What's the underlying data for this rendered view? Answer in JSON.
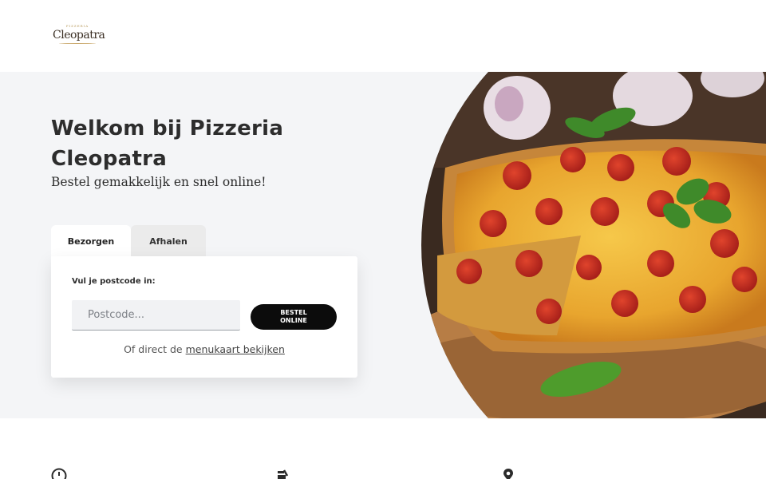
{
  "header": {
    "logo": {
      "arc_text": "PIZZERIA",
      "name": "Cleopatra"
    }
  },
  "hero": {
    "title": "Welkom bij Pizzeria Cleopatra",
    "subtitle": "Bestel gemakkelijk en snel online!"
  },
  "order": {
    "tabs": [
      {
        "label": "Bezorgen",
        "active": true
      },
      {
        "label": "Afhalen",
        "active": false
      }
    ],
    "postcode_label": "Vul je postcode in:",
    "postcode_placeholder": "Postcode...",
    "postcode_value": "",
    "button_label": "BESTEL ONLINE",
    "alt_prefix": "Of direct de",
    "alt_link": "menukaart bekijken"
  },
  "features": {
    "icons": [
      "clock-icon",
      "bike-icon",
      "location-pin-icon"
    ]
  },
  "colors": {
    "hero_bg": "#f4f5f7",
    "button_bg": "#0c0c0c",
    "logo_gold": "#c9a86b"
  }
}
